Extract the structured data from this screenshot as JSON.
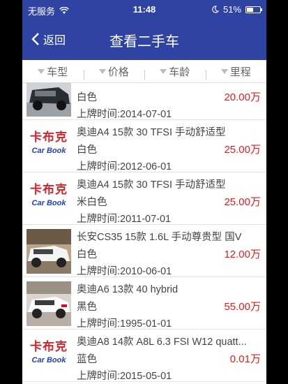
{
  "status": {
    "carrier": "无服务",
    "time": "11:48",
    "battery": "51%",
    "battery_level": 0.51
  },
  "nav": {
    "back_label": "返回",
    "title": "查看二手车"
  },
  "filters": [
    "车型",
    "价格",
    "车龄",
    "里程"
  ],
  "logo": {
    "cn": "卡布克",
    "en": "Car Book"
  },
  "cars": [
    {
      "name": "",
      "color": "白色",
      "price": "20.00万",
      "date": "上牌时间:2014-07-01",
      "thumb": "photo-suv-dark"
    },
    {
      "name": "奥迪A4 15款 30 TFSI 手动舒适型",
      "color": "白色",
      "price": "25.00万",
      "date": "上牌时间:2012-06-01",
      "thumb": "logo"
    },
    {
      "name": "奥迪A4 15款 30 TFSI 手动舒适型",
      "color": "米白色",
      "price": "25.00万",
      "date": "上牌时间:2011-07-01",
      "thumb": "logo"
    },
    {
      "name": "长安CS35 15款 1.6L 手动尊贵型 国V",
      "color": "白色",
      "price": "12.00万",
      "date": "上牌时间:2010-06-01",
      "thumb": "photo-suv-white"
    },
    {
      "name": "奥迪A6 13款 40 hybrid",
      "color": "黑色",
      "price": "55.00万",
      "date": "上牌时间:1995-01-01",
      "thumb": "photo-suv-white2"
    },
    {
      "name": "奥迪A8 14款 A8L 6.3 FSI W12 quatt...",
      "color": "蓝色",
      "price": "0.01万",
      "date": "上牌时间:2015-05-01",
      "thumb": "logo"
    }
  ]
}
